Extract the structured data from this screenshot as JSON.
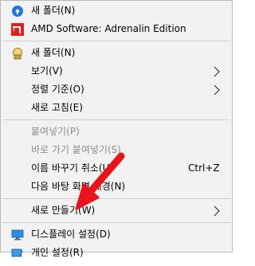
{
  "menu": {
    "items": [
      {
        "label": "새 폴더(N)",
        "icon": "blue-circle-arrow-icon"
      },
      {
        "label": "AMD Software: Adrenalin Edition",
        "icon": "amd-logo-icon"
      },
      {
        "label": "새 폴더(N)",
        "icon": "padlock-folder-icon"
      },
      {
        "label": "보기(V)",
        "submenu": true
      },
      {
        "label": "정렬 기준(O)",
        "submenu": true
      },
      {
        "label": "새로 고침(E)"
      },
      {
        "label": "붙여넣기(P)",
        "disabled": true
      },
      {
        "label": "바로 가기 붙여넣기(S)",
        "disabled": true
      },
      {
        "label": "이름 바꾸기 취소(U)",
        "shortcut": "Ctrl+Z"
      },
      {
        "label": "다음 바탕 화면 배경(N)"
      },
      {
        "label": "새로 만들기(W)",
        "submenu": true
      },
      {
        "label": "디스플레이 설정(D)",
        "icon": "display-settings-icon"
      },
      {
        "label": "개인 설정(R)",
        "icon": "personalize-icon"
      }
    ]
  },
  "colors": {
    "menu_background": "#f2f2f2",
    "disabled_text": "#8c8c8c",
    "annotation_arrow": "#e8141a"
  }
}
